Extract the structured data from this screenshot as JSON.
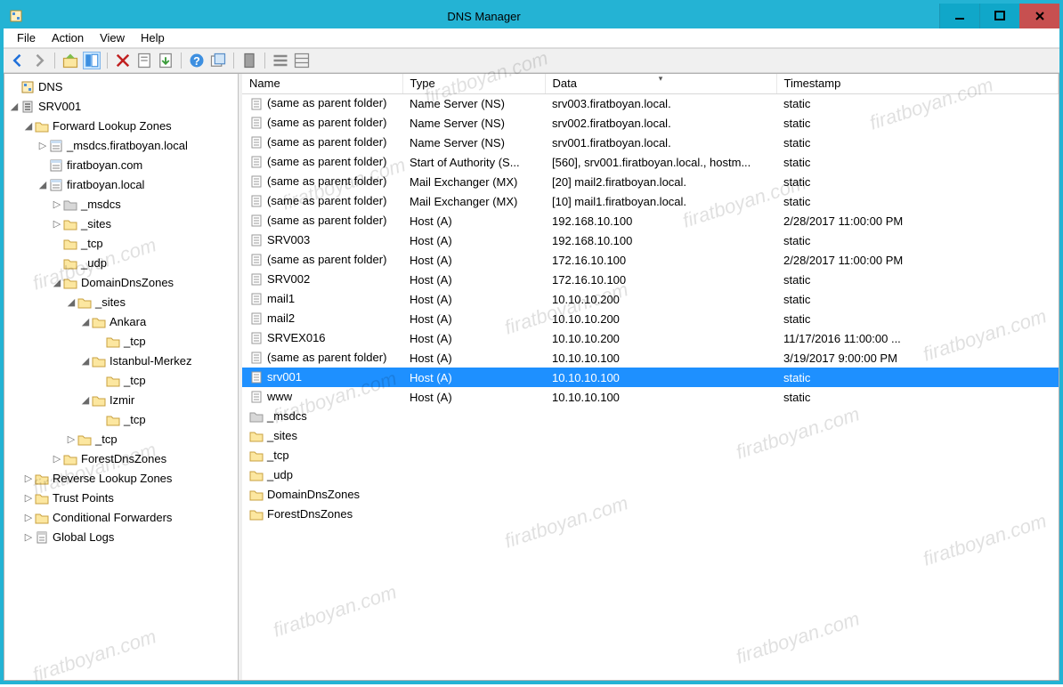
{
  "window": {
    "title": "DNS Manager"
  },
  "menu": {
    "file": "File",
    "action": "Action",
    "view": "View",
    "help": "Help"
  },
  "columns": {
    "name": "Name",
    "type": "Type",
    "data": "Data",
    "timestamp": "Timestamp"
  },
  "tree": {
    "root": "DNS",
    "server": "SRV001",
    "flz": "Forward Lookup Zones",
    "msdcs_zone": "_msdcs.firatboyan.local",
    "com_zone": "firatboyan.com",
    "local_zone": "firatboyan.local",
    "msdcs": "_msdcs",
    "sites": "_sites",
    "tcp": "_tcp",
    "udp": "_udp",
    "ddz": "DomainDnsZones",
    "ddz_sites": "_sites",
    "ankara": "Ankara",
    "ankara_tcp": "_tcp",
    "istanbul": "Istanbul-Merkez",
    "istanbul_tcp": "_tcp",
    "izmir": "Izmir",
    "izmir_tcp": "_tcp",
    "ddz_tcp": "_tcp",
    "fdz": "ForestDnsZones",
    "rlz": "Reverse Lookup Zones",
    "tp": "Trust Points",
    "cf": "Conditional Forwarders",
    "gl": "Global Logs"
  },
  "records": [
    {
      "name": "(same as parent folder)",
      "type": "Name Server (NS)",
      "data": "srv003.firatboyan.local.",
      "ts": "static",
      "icon": "rec"
    },
    {
      "name": "(same as parent folder)",
      "type": "Name Server (NS)",
      "data": "srv002.firatboyan.local.",
      "ts": "static",
      "icon": "rec"
    },
    {
      "name": "(same as parent folder)",
      "type": "Name Server (NS)",
      "data": "srv001.firatboyan.local.",
      "ts": "static",
      "icon": "rec"
    },
    {
      "name": "(same as parent folder)",
      "type": "Start of Authority (S...",
      "data": "[560], srv001.firatboyan.local., hostm...",
      "ts": "static",
      "icon": "rec"
    },
    {
      "name": "(same as parent folder)",
      "type": "Mail Exchanger (MX)",
      "data": "[20]  mail2.firatboyan.local.",
      "ts": "static",
      "icon": "rec"
    },
    {
      "name": "(same as parent folder)",
      "type": "Mail Exchanger (MX)",
      "data": "[10]  mail1.firatboyan.local.",
      "ts": "static",
      "icon": "rec"
    },
    {
      "name": "(same as parent folder)",
      "type": "Host (A)",
      "data": "192.168.10.100",
      "ts": "2/28/2017 11:00:00 PM",
      "icon": "rec"
    },
    {
      "name": "SRV003",
      "type": "Host (A)",
      "data": "192.168.10.100",
      "ts": "static",
      "icon": "rec"
    },
    {
      "name": "(same as parent folder)",
      "type": "Host (A)",
      "data": "172.16.10.100",
      "ts": "2/28/2017 11:00:00 PM",
      "icon": "rec"
    },
    {
      "name": "SRV002",
      "type": "Host (A)",
      "data": "172.16.10.100",
      "ts": "static",
      "icon": "rec"
    },
    {
      "name": "mail1",
      "type": "Host (A)",
      "data": "10.10.10.200",
      "ts": "static",
      "icon": "rec"
    },
    {
      "name": "mail2",
      "type": "Host (A)",
      "data": "10.10.10.200",
      "ts": "static",
      "icon": "rec"
    },
    {
      "name": "SRVEX016",
      "type": "Host (A)",
      "data": "10.10.10.200",
      "ts": "11/17/2016 11:00:00 ...",
      "icon": "rec"
    },
    {
      "name": "(same as parent folder)",
      "type": "Host (A)",
      "data": "10.10.10.100",
      "ts": "3/19/2017 9:00:00 PM",
      "icon": "rec"
    },
    {
      "name": "srv001",
      "type": "Host (A)",
      "data": "10.10.10.100",
      "ts": "static",
      "icon": "rec",
      "selected": true
    },
    {
      "name": "www",
      "type": "Host (A)",
      "data": "10.10.10.100",
      "ts": "static",
      "icon": "rec"
    },
    {
      "name": "_msdcs",
      "type": "",
      "data": "",
      "ts": "",
      "icon": "folder-gray"
    },
    {
      "name": "_sites",
      "type": "",
      "data": "",
      "ts": "",
      "icon": "folder"
    },
    {
      "name": "_tcp",
      "type": "",
      "data": "",
      "ts": "",
      "icon": "folder"
    },
    {
      "name": "_udp",
      "type": "",
      "data": "",
      "ts": "",
      "icon": "folder"
    },
    {
      "name": "DomainDnsZones",
      "type": "",
      "data": "",
      "ts": "",
      "icon": "folder"
    },
    {
      "name": "ForestDnsZones",
      "type": "",
      "data": "",
      "ts": "",
      "icon": "folder"
    }
  ],
  "watermark": "firatboyan.com"
}
